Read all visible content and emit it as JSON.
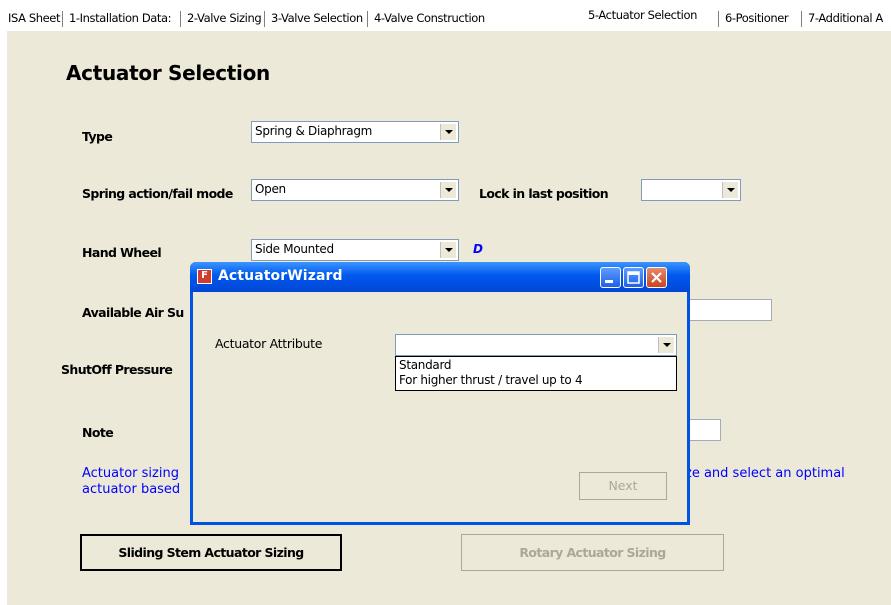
{
  "tabs": [
    {
      "label": "ISA Sheet",
      "active": false
    },
    {
      "label": "1-Installation Data:",
      "active": false
    },
    {
      "label": "2-Valve Sizing",
      "active": false
    },
    {
      "label": "3-Valve Selection",
      "active": false
    },
    {
      "label": "4-Valve Construction",
      "active": false
    },
    {
      "label": "5-Actuator Selection",
      "active": true
    },
    {
      "label": "6-Positioner",
      "active": false
    },
    {
      "label": "7-Additional A",
      "active": false
    }
  ],
  "page": {
    "title": "Actuator Selection",
    "type_label": "Type",
    "type_value": "Spring & Diaphragm",
    "spring_label": "Spring action/fail mode",
    "spring_value": "Open",
    "lock_label": "Lock in last position",
    "lock_value": "",
    "handwheel_label": "Hand Wheel",
    "handwheel_value": "Side Mounted",
    "handwheel_link": "D",
    "air_label": "Available Air Su",
    "shutoff_label": "ShutOff Pressure",
    "note_label": "Note",
    "info_line1_start": "Actuator sizing ",
    "info_line1_end": "ze and select an optimal",
    "info_line2_start": "actuator based ",
    "sliding_button": "Sliding Stem Actuator Sizing",
    "rotary_button": "Rotary Actuator Sizing"
  },
  "dialog": {
    "icon_letter": "F",
    "title": "ActuatorWizard",
    "attr_label": "Actuator Attribute",
    "attr_value": "",
    "options": [
      "Standard",
      "For higher thrust / travel up to 4"
    ],
    "next_button": "Next"
  },
  "colors": {
    "link": "#0000ff",
    "titlebar": "#0054e3",
    "panel": "#ece9d8"
  }
}
